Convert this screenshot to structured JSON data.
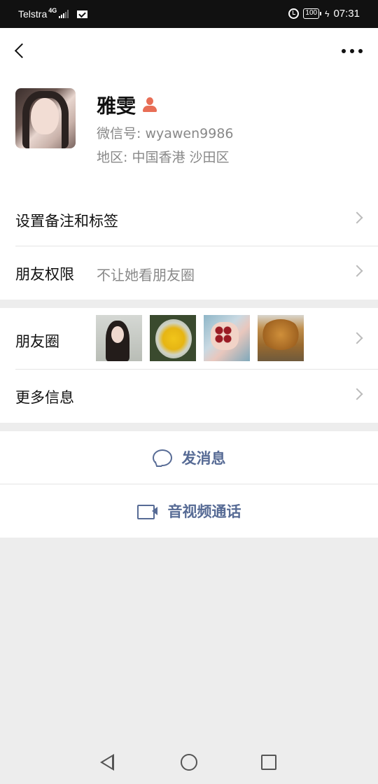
{
  "status_bar": {
    "carrier": "Telstra",
    "network": "4G",
    "battery": "100",
    "time": "07:31"
  },
  "nav": {
    "back_icon": "chevron-left-icon",
    "more_icon": "more-horizontal-icon"
  },
  "profile": {
    "name": "雅雯",
    "gender_icon": "female-person-icon",
    "gender_color": "#e86e56",
    "wechat_id": "微信号: wyawen9986",
    "region": "地区: 中国香港  沙田区"
  },
  "rows": {
    "remark": {
      "label": "设置备注和标签"
    },
    "permission": {
      "label": "朋友权限",
      "value": "不让她看朋友圈"
    },
    "moments": {
      "label": "朋友圈"
    },
    "more_info": {
      "label": "更多信息"
    }
  },
  "actions": {
    "message": {
      "label": "发消息",
      "icon": "chat-bubble-icon"
    },
    "call": {
      "label": "音视频通话",
      "icon": "video-camera-icon"
    },
    "accent_color": "#576b95"
  }
}
